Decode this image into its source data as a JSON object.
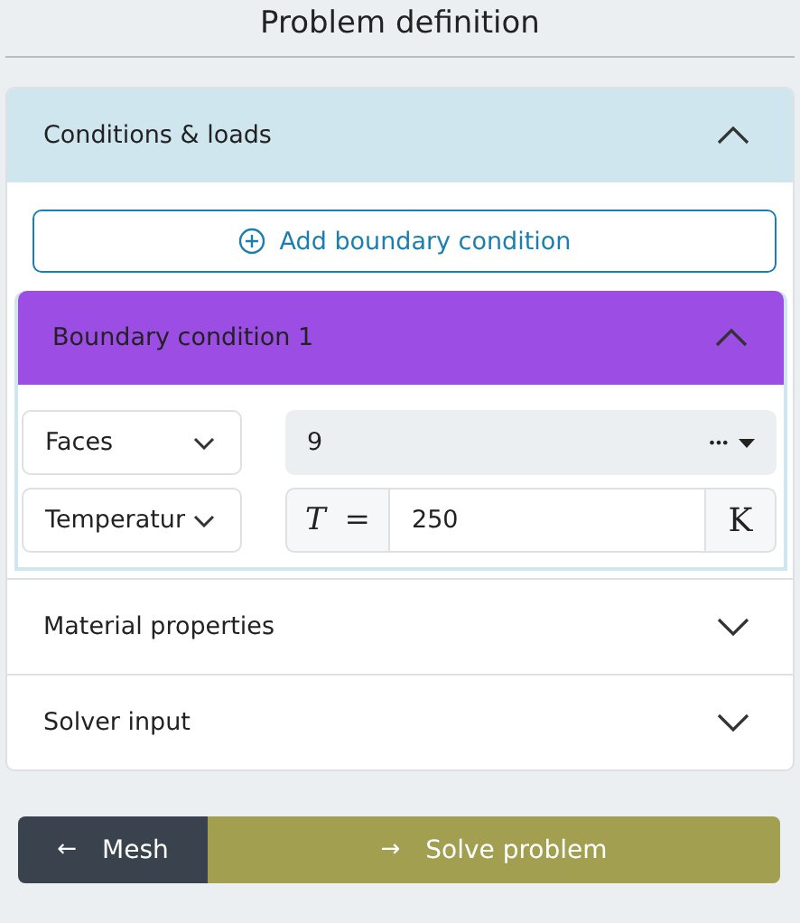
{
  "title": "Problem definition",
  "sections": [
    {
      "title": "Conditions & loads",
      "expanded": true,
      "add_button": "Add boundary condition",
      "conditions": [
        {
          "title": "Boundary condition 1",
          "expanded": true,
          "rows": [
            {
              "kind": "selection",
              "type": "Faces",
              "value": "9",
              "menu": "•••"
            },
            {
              "kind": "quantity",
              "type": "Temperatur",
              "symbol": "*T* =",
              "value": "250",
              "unit": "K"
            }
          ]
        }
      ]
    },
    {
      "title": "Material properties",
      "expanded": false
    },
    {
      "title": "Solver input",
      "expanded": false
    }
  ],
  "footer": {
    "back": {
      "arrow": "←",
      "label": "Mesh"
    },
    "next": {
      "arrow": "→",
      "label": "Solve problem"
    }
  }
}
